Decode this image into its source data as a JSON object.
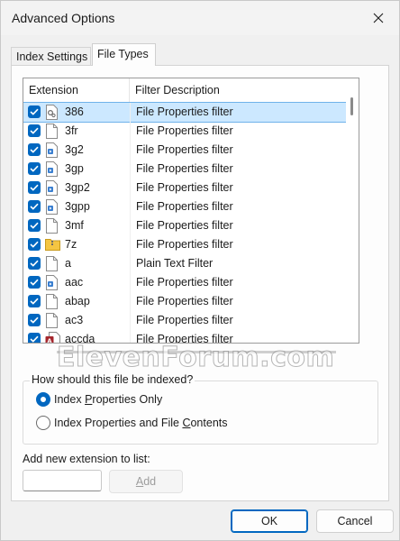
{
  "window": {
    "title": "Advanced Options"
  },
  "tabs": [
    {
      "label": "Index Settings",
      "active": false
    },
    {
      "label": "File Types",
      "active": true
    }
  ],
  "list": {
    "columns": {
      "extension": "Extension",
      "description": "Filter Description"
    },
    "rows": [
      {
        "ext": "386",
        "desc": "File Properties filter",
        "icon": "system-file-icon",
        "checked": true,
        "selected": true
      },
      {
        "ext": "3fr",
        "desc": "File Properties filter",
        "icon": "blank-file-icon",
        "checked": true
      },
      {
        "ext": "3g2",
        "desc": "File Properties filter",
        "icon": "media-file-icon",
        "checked": true
      },
      {
        "ext": "3gp",
        "desc": "File Properties filter",
        "icon": "media-file-icon",
        "checked": true
      },
      {
        "ext": "3gp2",
        "desc": "File Properties filter",
        "icon": "media-file-icon",
        "checked": true
      },
      {
        "ext": "3gpp",
        "desc": "File Properties filter",
        "icon": "media-file-icon",
        "checked": true
      },
      {
        "ext": "3mf",
        "desc": "File Properties filter",
        "icon": "blank-file-icon",
        "checked": true
      },
      {
        "ext": "7z",
        "desc": "File Properties filter",
        "icon": "zip-folder-icon",
        "checked": true
      },
      {
        "ext": "a",
        "desc": "Plain Text Filter",
        "icon": "blank-file-icon",
        "checked": true
      },
      {
        "ext": "aac",
        "desc": "File Properties filter",
        "icon": "media-file-icon",
        "checked": true
      },
      {
        "ext": "abap",
        "desc": "File Properties filter",
        "icon": "blank-file-icon",
        "checked": true
      },
      {
        "ext": "ac3",
        "desc": "File Properties filter",
        "icon": "blank-file-icon",
        "checked": true
      },
      {
        "ext": "accda",
        "desc": "File Properties filter",
        "icon": "access-file-icon",
        "checked": true
      }
    ]
  },
  "index_group": {
    "label": "How should this file be indexed?",
    "options": [
      {
        "label_pre": "Index ",
        "label_u": "P",
        "label_post": "roperties Only",
        "checked": true
      },
      {
        "label_pre": "Index Properties and File ",
        "label_u": "C",
        "label_post": "ontents",
        "checked": false
      }
    ]
  },
  "add_extension": {
    "label": "Add new extension to list:",
    "value": "",
    "button_u": "A",
    "button_rest": "dd"
  },
  "footer": {
    "ok": "OK",
    "cancel": "Cancel"
  },
  "watermark": "ElevenForum.com",
  "colors": {
    "accent": "#0067c0",
    "selection": "#cce8ff"
  }
}
